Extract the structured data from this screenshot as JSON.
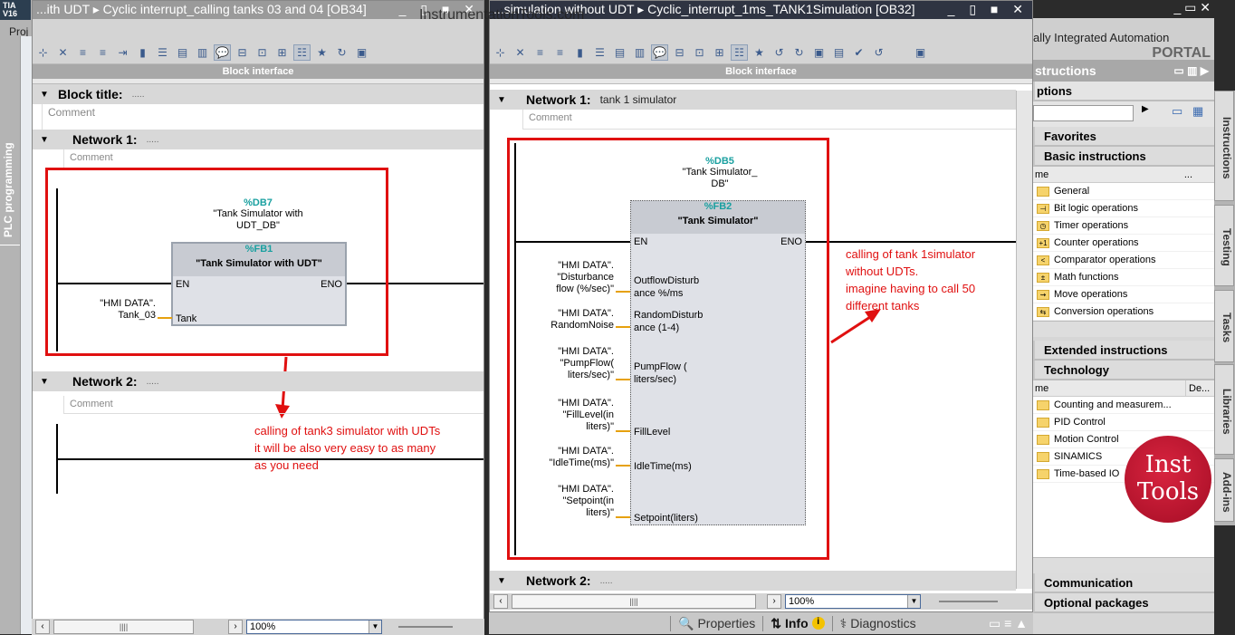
{
  "app": {
    "logo": "TIA V16",
    "project_menu": "Proj",
    "left_vertical_label": "PLC programming",
    "watermark": "InstrumentationTools.com",
    "badge": {
      "line1": "Inst",
      "line2": "Tools"
    }
  },
  "left_editor": {
    "title": "...ith UDT  ▸  Cyclic interrupt_calling tanks 03 and 04 [OB34]",
    "block_interface": "Block interface",
    "block_title": {
      "label": "Block title:",
      "dots": "....."
    },
    "block_comment": "Comment",
    "networks": [
      {
        "label": "Network 1:",
        "dots": ".....",
        "comment": "Comment",
        "db": {
          "number": "%DB7",
          "name": "\"Tank Simulator with UDT_DB\""
        },
        "fb": {
          "number": "%FB1",
          "name": "\"Tank Simulator with UDT\"",
          "en": "EN",
          "eno": "ENO",
          "inputs": [
            {
              "pin": "Tank",
              "param_line1": "\"HMI DATA\".",
              "param_line2": "Tank_03"
            }
          ]
        }
      },
      {
        "label": "Network 2:",
        "dots": ".....",
        "comment": "Comment"
      }
    ],
    "annotation": [
      "calling of tank3 simulator with UDTs",
      "it will be also very easy to as many",
      "as you need"
    ],
    "zoom": "100%"
  },
  "right_editor": {
    "title": "...simulation without UDT  ▸  Cyclic_interrupt_1ms_TANK1Simulation [OB32]",
    "block_interface": "Block interface",
    "networks": [
      {
        "label": "Network 1:",
        "title": "tank 1 simulator",
        "comment": "Comment",
        "db": {
          "number": "%DB5",
          "name_line1": "\"Tank Simulator_",
          "name_line2": "DB\""
        },
        "fb": {
          "number": "%FB2",
          "name": "\"Tank Simulator\"",
          "en": "EN",
          "eno": "ENO",
          "inputs": [
            {
              "pin1": "OutflowDisturb",
              "pin2": "ance %/ms",
              "p1": "\"HMI DATA\".",
              "p2": "\"Disturbance",
              "p3": "flow (%/sec)\""
            },
            {
              "pin1": "RandomDisturb",
              "pin2": "ance (1-4)",
              "p1": "\"HMI DATA\".",
              "p2": "RandomNoise",
              "p3": ""
            },
            {
              "pin1": "PumpFlow (",
              "pin2": "liters/sec)",
              "p1": "\"HMI DATA\".",
              "p2": "\"PumpFlow(",
              "p3": "liters/sec)\""
            },
            {
              "pin1": "FillLevel",
              "pin2": "",
              "p1": "\"HMI DATA\".",
              "p2": "\"FillLevel(in",
              "p3": "liters)\""
            },
            {
              "pin1": "IdleTime(ms)",
              "pin2": "",
              "p1": "\"HMI DATA\".",
              "p2": "\"IdleTime(ms)\"",
              "p3": ""
            },
            {
              "pin1": "Setpoint(liters)",
              "pin2": "",
              "p1": "\"HMI DATA\".",
              "p2": "\"Setpoint(in",
              "p3": "liters)\""
            }
          ]
        }
      },
      {
        "label": "Network 2:",
        "dots": "....."
      }
    ],
    "annotation": [
      "calling of tank 1simulator",
      "without UDTs.",
      "imagine having to call 50",
      "different tanks"
    ],
    "zoom": "100%"
  },
  "status_tabs": [
    {
      "label": "Properties"
    },
    {
      "label": "Info"
    },
    {
      "label": "Diagnostics"
    }
  ],
  "right_panel": {
    "brand_line": "ally Integrated Automation",
    "brand_portal": "PORTAL",
    "header": "structions",
    "options": "ptions",
    "sections_top": [
      "Favorites",
      "Basic instructions"
    ],
    "basic_col": "me",
    "basic_items": [
      {
        "label": "General",
        "glyph": ""
      },
      {
        "label": "Bit logic operations",
        "glyph": "⊣"
      },
      {
        "label": "Timer operations",
        "glyph": "◷"
      },
      {
        "label": "Counter operations",
        "glyph": "+1"
      },
      {
        "label": "Comparator operations",
        "glyph": "<"
      },
      {
        "label": "Math functions",
        "glyph": "±"
      },
      {
        "label": "Move operations",
        "glyph": "⇝"
      },
      {
        "label": "Conversion operations",
        "glyph": "⇆"
      }
    ],
    "sections_mid": [
      "Extended instructions",
      "Technology"
    ],
    "tech_col_name": "me",
    "tech_col_desc": "De...",
    "tech_items": [
      "Counting and measurem...",
      "PID Control",
      "Motion Control",
      "SINAMICS",
      "Time-based IO"
    ],
    "sections_bottom": [
      "Communication",
      "Optional packages"
    ],
    "vertical_tabs": [
      "Instructions",
      "Testing",
      "Tasks",
      "Libraries",
      "Add-ins"
    ]
  }
}
